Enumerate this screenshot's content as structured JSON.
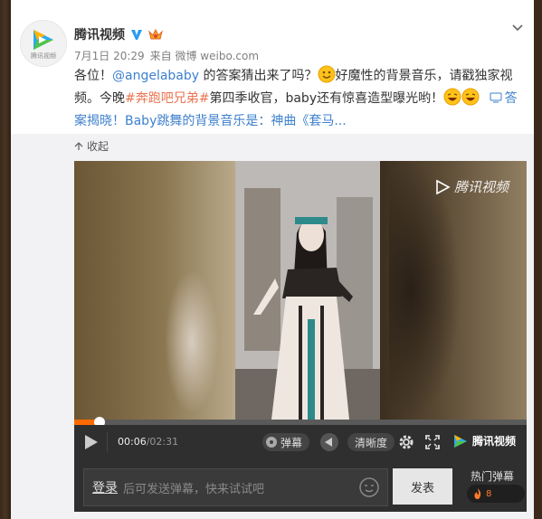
{
  "post": {
    "author_name": "腾讯视频",
    "avatar_sub": "腾讯视频",
    "date": "7月1日 20:29",
    "source": "来自 微博 weibo.com",
    "text_prefix": "各位！",
    "mention": "@angelababy",
    "text_mid1": " 的答案猜出来了吗？",
    "text_mid2": "好魔性的背景音乐，请戳独家视频。今晚",
    "hashtag1": "#奔跑吧兄弟#",
    "text_mid3": "第四季收官，baby还有惊喜造型曝光哟！",
    "link_text": "答案揭晓！Baby跳舞的背景音乐是：神曲《套马...",
    "collapse_label": "收起"
  },
  "video": {
    "watermark": "腾讯视频",
    "current_time": "00:06",
    "total_time": "/02:31",
    "progress": 0.055,
    "danmaku_label": "弹幕",
    "definition_label": "清晰度",
    "brand_label": "腾讯视频"
  },
  "danmaku_bar": {
    "login_label": "登录",
    "placeholder": "后可发送弹幕，快来试试吧",
    "send_label": "发表",
    "hot_label": "热门弹幕",
    "hot_count": "8"
  },
  "colors": {
    "accent": "#eb7350",
    "brand_blue": "#3e80cc",
    "progress": "#ff6a00"
  }
}
